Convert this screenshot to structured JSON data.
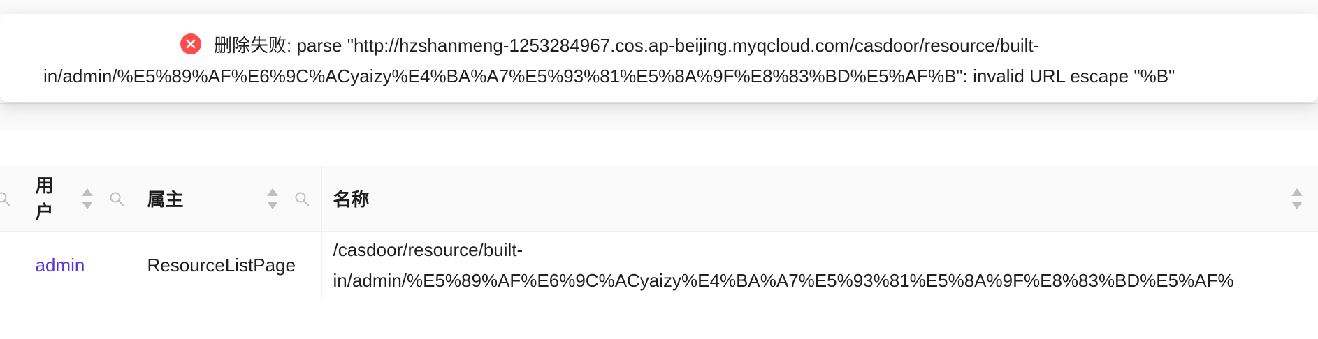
{
  "toast": {
    "type": "error",
    "icon": "close-circle-icon",
    "line1": "删除失败: parse \"http://hzshanmeng-1253284967.cos.ap-beijing.myqcloud.com/casdoor/resource/built-",
    "line2": "in/admin/%E5%89%AF%E6%9C%ACyaizy%E4%BA%A7%E5%93%81%E5%8A%9F%E8%83%BD%E5%AF%B\": invalid URL escape \"%B\""
  },
  "table": {
    "columns": [
      {
        "title_line1": "用",
        "title_line2": "户",
        "sortable": true,
        "filterable": true
      },
      {
        "title": "属主",
        "sortable": true,
        "filterable": true
      },
      {
        "title": "名称",
        "sortable": true,
        "filterable": false
      }
    ],
    "rows": [
      {
        "user": "admin",
        "owner": "ResourceListPage",
        "name_line1": "/casdoor/resource/built-",
        "name_line2": "in/admin/%E5%89%AF%E6%9C%ACyaizy%E4%BA%A7%E5%93%81%E5%8A%9F%E8%83%BD%E5%AF%"
      }
    ]
  },
  "colors": {
    "error": "#ff4d4f",
    "link": "#5734d3",
    "header_bg": "#fafafa",
    "border": "#f0f0f0"
  }
}
